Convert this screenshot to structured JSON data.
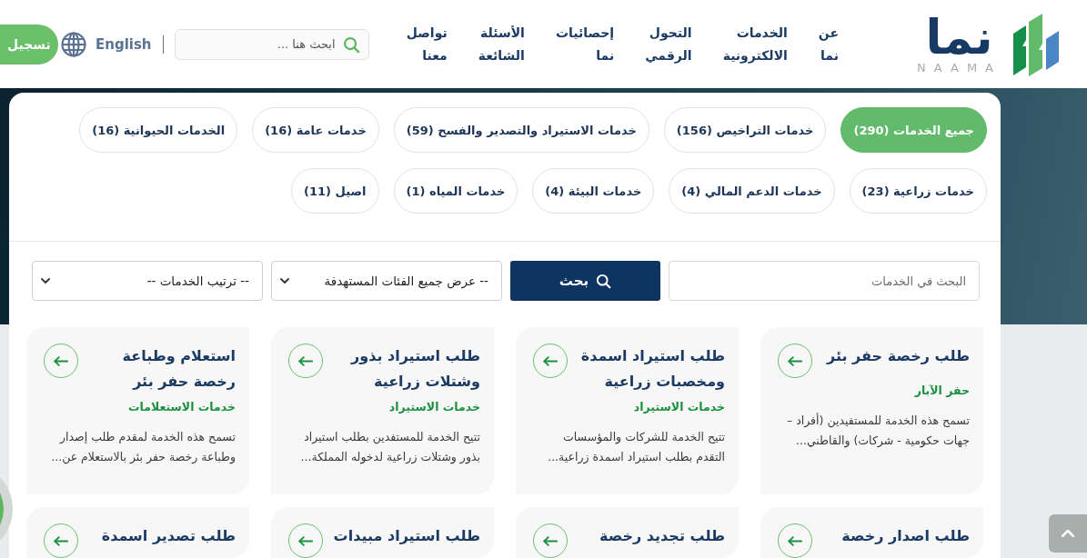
{
  "header": {
    "logo": {
      "name": "نما",
      "subtitle": "NAAMA"
    },
    "nav": [
      {
        "label": "عن نما"
      },
      {
        "label": "الخدمات الالكترونية"
      },
      {
        "label": "التحول الرقمي"
      },
      {
        "label": "إحصائيات نما"
      },
      {
        "label": "الأسئلة الشائعة"
      },
      {
        "label": "تواصل معنا"
      }
    ],
    "search": {
      "placeholder": "ابحث هنا ..."
    },
    "language": "English",
    "login_button": "تسجيل"
  },
  "filters": [
    {
      "label": "جميع الخدمات (290)",
      "selected": true
    },
    {
      "label": "خدمات التراخيص (156)",
      "selected": false
    },
    {
      "label": "خدمات الاستيراد والتصدير والفسح (59)",
      "selected": false
    },
    {
      "label": "خدمات عامة (16)",
      "selected": false
    },
    {
      "label": "الخدمات الحيوانية (16)",
      "selected": false
    },
    {
      "label": "خدمات زراعية (23)",
      "selected": false
    },
    {
      "label": "خدمات الدعم المالي (4)",
      "selected": false
    },
    {
      "label": "خدمات البيئة (4)",
      "selected": false
    },
    {
      "label": "خدمات المياه (1)",
      "selected": false
    },
    {
      "label": "اصيل (11)",
      "selected": false
    }
  ],
  "toolbar": {
    "search": {
      "placeholder": "البحث في الخدمات"
    },
    "search_button": "بحث",
    "category_select": "-- عرض جميع الفئات المستهدفة",
    "sort_select": "-- ترتيب الخدمات --"
  },
  "services": [
    {
      "title": "طلب رخصة حفر بئر",
      "category": "حفر الآبار",
      "description": "تسمح هذه الخدمة للمستفيدين (أفراد – جهات حكومية - شركات) والقاطني..."
    },
    {
      "title": "طلب استيراد اسمدة ومخصبات زراعية",
      "category": "خدمات الاستيراد",
      "description": "تتيح الخدمة للشركات والمؤسسات التقدم بطلب استيراد اسمدة زراعية..."
    },
    {
      "title": "طلب استيراد بذور وشتلات زراعية",
      "category": "خدمات الاستيراد",
      "description": "تتيح الخدمة للمستفدين بطلب استيراد بذور وشتلات زراعية لدخوله المملكة..."
    },
    {
      "title": "استعلام وطباعة رخصة حفر بئر",
      "category": "خدمات الاستعلامات",
      "description": "تسمح هذه الخدمة لمقدم طلب إصدار وطباعة رخصة حفر بئر بالاستعلام عن..."
    },
    {
      "title": "طلب اصدار رخصة"
    },
    {
      "title": "طلب تجديد رخصة"
    },
    {
      "title": "طلب استيراد مبيدات"
    },
    {
      "title": "طلب تصدير اسمدة"
    }
  ]
}
